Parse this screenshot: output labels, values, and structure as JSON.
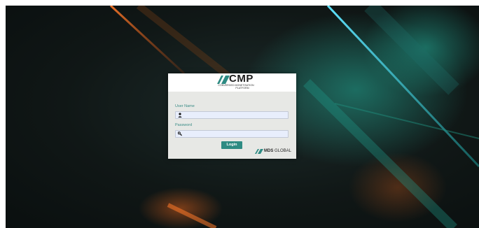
{
  "brand": {
    "logo_title": "CMP",
    "logo_subtitle_line1": "CONVERGED MONETISATION",
    "logo_subtitle_line2": "PLATFORM",
    "accent_color": "#2e8b83",
    "logo_icon": "cmp-logo-icon"
  },
  "form": {
    "username_label": "User Name",
    "username_value": "",
    "username_icon": "user-icon",
    "password_label": "Password",
    "password_value": "",
    "password_icon": "key-icon",
    "login_label": "Login"
  },
  "footer": {
    "company_bold": "MDS",
    "company_rest": " GLOBAL",
    "company_icon": "mds-logo-icon"
  }
}
